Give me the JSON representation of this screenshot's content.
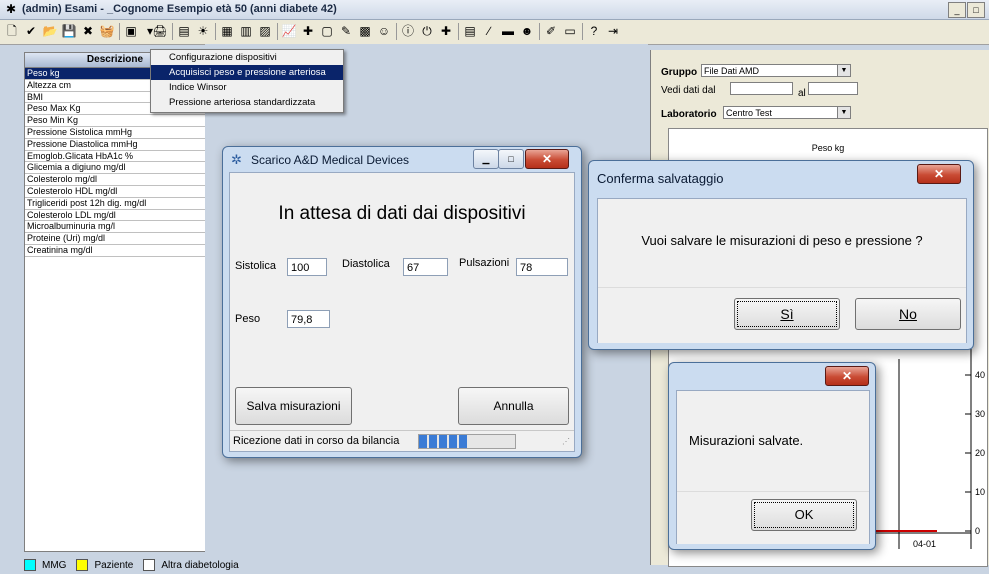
{
  "window": {
    "title": "(admin) Esami - _Cognome Esempio età 50 (anni diabete 42)",
    "controls": [
      "_",
      "□"
    ]
  },
  "toolbar": {
    "icons": [
      "new-icon",
      "check-icon",
      "open-icon",
      "save-icon",
      "delete-icon",
      "basket-icon",
      "devices-icon",
      "dropdown-arrow-icon",
      "print-icon",
      "list-icon",
      "lightbulb-icon",
      "image-icon",
      "doc-icon",
      "chart-icon",
      "graph-icon",
      "tool-icon",
      "note-icon",
      "pen-icon",
      "book-icon",
      "people-icon",
      "info-icon",
      "power-icon",
      "key-icon",
      "card-icon",
      "line-icon",
      "flag-icon",
      "face-icon",
      "edit-icon",
      "monitor-icon",
      "help-icon",
      "exit-icon"
    ]
  },
  "menu": {
    "items": [
      {
        "label": "Configurazione dispositivi"
      },
      {
        "label": "Acquisisci peso e pressione arteriosa",
        "highlighted": true
      },
      {
        "label": "Indice Winsor"
      },
      {
        "label": "Pressione arteriosa standardizzata"
      }
    ]
  },
  "left_panel": {
    "header": "Descrizione",
    "items": [
      "Peso kg",
      "Altezza cm",
      "BMI",
      "Peso Max Kg",
      "Peso Min Kg",
      "Pressione Sistolica mmHg",
      "Pressione Diastolica mmHg",
      "Emoglob.Glicata HbA1c %",
      "Glicemia a digiuno mg/dl",
      "Colesterolo mg/dl",
      "Colesterolo HDL mg/dl",
      "Trigliceridi post 12h dig. mg/dl",
      "Colesterolo LDL mg/dl",
      "Microalbuminuria mg/l",
      "Proteine (Uri) mg/dl",
      "Creatinina mg/dl"
    ],
    "selected_index": 0
  },
  "right_panel": {
    "gruppo_label": "Gruppo",
    "gruppo_value": "File Dati AMD",
    "vedi_dati_dal_label": "Vedi dati dal",
    "al_label": "al",
    "laboratorio_label": "Laboratorio",
    "laboratorio_value": "Centro Test",
    "chart_title": "Peso kg",
    "y_ticks": [
      "40",
      "30",
      "20",
      "10",
      "0"
    ],
    "x_tick": "04-01"
  },
  "legend": {
    "items": [
      {
        "label": "MMG",
        "color": "#00ffff"
      },
      {
        "label": "Paziente",
        "color": "#ffff00"
      },
      {
        "label": "Altra diabetologia",
        "color": "#ffffff"
      }
    ]
  },
  "dialog_devices": {
    "title": "Scarico A&D Medical Devices",
    "heading": "In attesa di dati dai dispositivi",
    "sistolica_label": "Sistolica",
    "sistolica_value": "100",
    "diastolica_label": "Diastolica",
    "diastolica_value": "67",
    "pulsazioni_label": "Pulsazioni",
    "pulsazioni_value": "78",
    "peso_label": "Peso",
    "peso_value": "79,8",
    "save_label": "Salva misurazioni",
    "cancel_label": "Annulla",
    "status_text": "Ricezione dati in corso da bilancia",
    "progress_fraction": 0.5
  },
  "dialog_confirm": {
    "title": "Conferma salvataggio",
    "message": "Vuoi salvare le misurazioni di peso e pressione ?",
    "yes_label": "Sì",
    "no_label": "No"
  },
  "dialog_saved": {
    "message": "Misurazioni salvate.",
    "ok_label": "OK"
  },
  "colors": {
    "selection": "#0a246a",
    "chart_line": "#cc0000",
    "progress": "#3a7bd5"
  }
}
